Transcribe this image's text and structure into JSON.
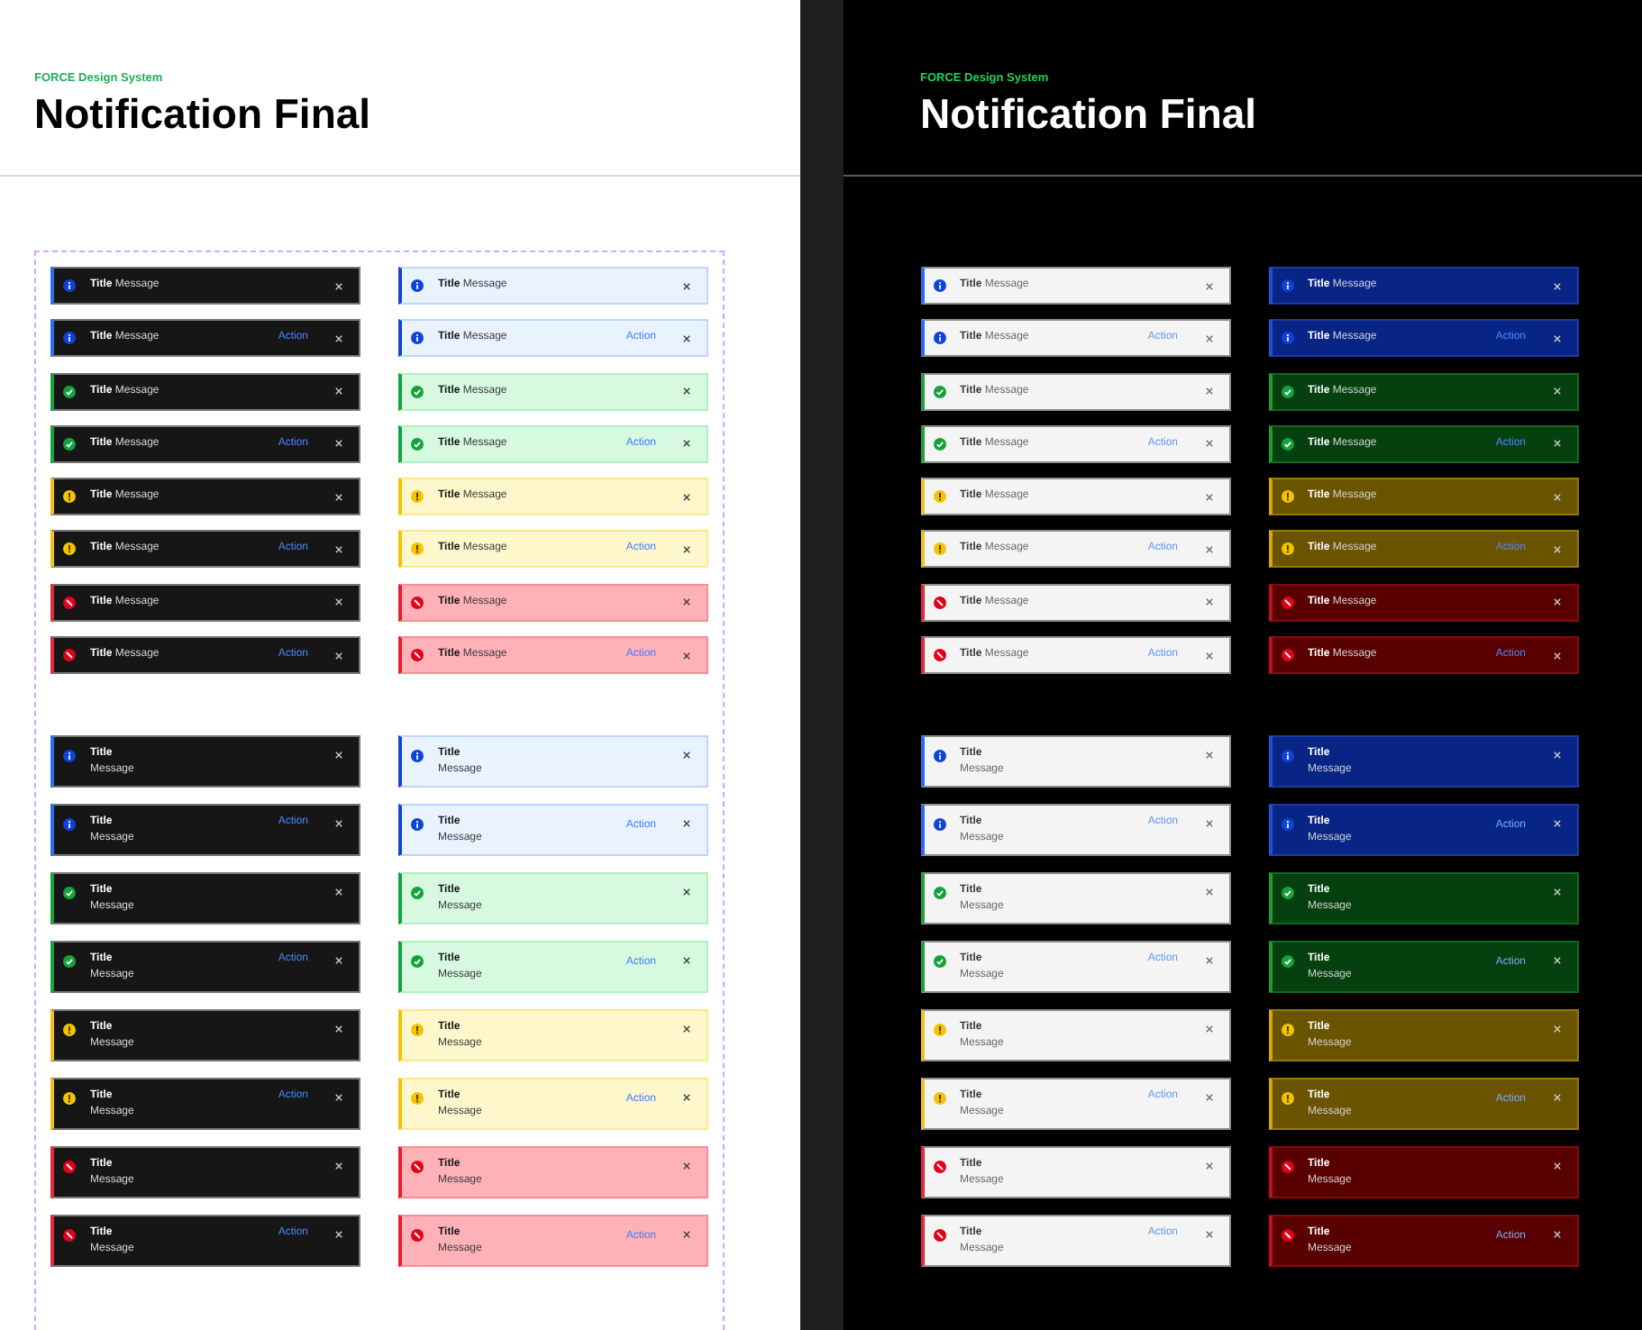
{
  "panels": [
    {
      "eyebrow": "FORCE Design System",
      "title": "Notification Final",
      "framed": true,
      "sections": [
        {
          "columns": [
            {
              "notifications": [
                {
                  "kind": "info",
                  "title": "Title",
                  "message": "Message"
                },
                {
                  "kind": "info",
                  "title": "Title",
                  "message": "Message",
                  "action": "Action"
                },
                {
                  "kind": "success",
                  "title": "Title",
                  "message": "Message"
                },
                {
                  "kind": "success",
                  "title": "Title",
                  "message": "Message",
                  "action": "Action"
                },
                {
                  "kind": "warning",
                  "title": "Title",
                  "message": "Message"
                },
                {
                  "kind": "warning",
                  "title": "Title",
                  "message": "Message",
                  "action": "Action"
                },
                {
                  "kind": "error",
                  "title": "Title",
                  "message": "Message"
                },
                {
                  "kind": "error",
                  "title": "Title",
                  "message": "Message",
                  "action": "Action"
                }
              ]
            },
            {
              "notifications": [
                {
                  "kind": "info",
                  "title": "Title",
                  "message": "Message"
                },
                {
                  "kind": "info",
                  "title": "Title",
                  "message": "Message",
                  "action": "Action"
                },
                {
                  "kind": "success",
                  "title": "Title",
                  "message": "Message"
                },
                {
                  "kind": "success",
                  "title": "Title",
                  "message": "Message",
                  "action": "Action"
                },
                {
                  "kind": "warning",
                  "title": "Title",
                  "message": "Message"
                },
                {
                  "kind": "warning",
                  "title": "Title",
                  "message": "Message",
                  "action": "Action"
                },
                {
                  "kind": "error",
                  "title": "Title",
                  "message": "Message"
                },
                {
                  "kind": "error",
                  "title": "Title",
                  "message": "Message",
                  "action": "Action"
                }
              ]
            }
          ]
        },
        {
          "columns": [
            {
              "notifications": [
                {
                  "kind": "info",
                  "title": "Title",
                  "message": "Message"
                },
                {
                  "kind": "info",
                  "title": "Title",
                  "message": "Message",
                  "action": "Action"
                },
                {
                  "kind": "success",
                  "title": "Title",
                  "message": "Message"
                },
                {
                  "kind": "success",
                  "title": "Title",
                  "message": "Message",
                  "action": "Action"
                },
                {
                  "kind": "warning",
                  "title": "Title",
                  "message": "Message"
                },
                {
                  "kind": "warning",
                  "title": "Title",
                  "message": "Message",
                  "action": "Action"
                },
                {
                  "kind": "error",
                  "title": "Title",
                  "message": "Message"
                },
                {
                  "kind": "error",
                  "title": "Title",
                  "message": "Message",
                  "action": "Action"
                }
              ]
            },
            {
              "notifications": [
                {
                  "kind": "info",
                  "title": "Title",
                  "message": "Message"
                },
                {
                  "kind": "info",
                  "title": "Title",
                  "message": "Message",
                  "action": "Action"
                },
                {
                  "kind": "success",
                  "title": "Title",
                  "message": "Message"
                },
                {
                  "kind": "success",
                  "title": "Title",
                  "message": "Message",
                  "action": "Action"
                },
                {
                  "kind": "warning",
                  "title": "Title",
                  "message": "Message"
                },
                {
                  "kind": "warning",
                  "title": "Title",
                  "message": "Message",
                  "action": "Action"
                },
                {
                  "kind": "error",
                  "title": "Title",
                  "message": "Message"
                },
                {
                  "kind": "error",
                  "title": "Title",
                  "message": "Message",
                  "action": "Action"
                }
              ]
            }
          ]
        }
      ]
    },
    {
      "eyebrow": "FORCE Design System",
      "title": "Notification Final",
      "framed": false,
      "sections": [
        {
          "columns": [
            {
              "notifications": [
                {
                  "kind": "info",
                  "title": "Title",
                  "message": "Message"
                },
                {
                  "kind": "info",
                  "title": "Title",
                  "message": "Message",
                  "action": "Action"
                },
                {
                  "kind": "success",
                  "title": "Title",
                  "message": "Message"
                },
                {
                  "kind": "success",
                  "title": "Title",
                  "message": "Message",
                  "action": "Action"
                },
                {
                  "kind": "warning",
                  "title": "Title",
                  "message": "Message"
                },
                {
                  "kind": "warning",
                  "title": "Title",
                  "message": "Message",
                  "action": "Action"
                },
                {
                  "kind": "error",
                  "title": "Title",
                  "message": "Message"
                },
                {
                  "kind": "error",
                  "title": "Title",
                  "message": "Message",
                  "action": "Action"
                }
              ]
            },
            {
              "notifications": [
                {
                  "kind": "info",
                  "title": "Title",
                  "message": "Message"
                },
                {
                  "kind": "info",
                  "title": "Title",
                  "message": "Message",
                  "action": "Action"
                },
                {
                  "kind": "success",
                  "title": "Title",
                  "message": "Message"
                },
                {
                  "kind": "success",
                  "title": "Title",
                  "message": "Message",
                  "action": "Action"
                },
                {
                  "kind": "warning",
                  "title": "Title",
                  "message": "Message"
                },
                {
                  "kind": "warning",
                  "title": "Title",
                  "message": "Message",
                  "action": "Action"
                },
                {
                  "kind": "error",
                  "title": "Title",
                  "message": "Message"
                },
                {
                  "kind": "error",
                  "title": "Title",
                  "message": "Message",
                  "action": "Action"
                }
              ]
            }
          ]
        },
        {
          "columns": [
            {
              "notifications": [
                {
                  "kind": "info",
                  "title": "Title",
                  "message": "Message"
                },
                {
                  "kind": "info",
                  "title": "Title",
                  "message": "Message",
                  "action": "Action"
                },
                {
                  "kind": "success",
                  "title": "Title",
                  "message": "Message"
                },
                {
                  "kind": "success",
                  "title": "Title",
                  "message": "Message",
                  "action": "Action"
                },
                {
                  "kind": "warning",
                  "title": "Title",
                  "message": "Message"
                },
                {
                  "kind": "warning",
                  "title": "Title",
                  "message": "Message",
                  "action": "Action"
                },
                {
                  "kind": "error",
                  "title": "Title",
                  "message": "Message"
                },
                {
                  "kind": "error",
                  "title": "Title",
                  "message": "Message",
                  "action": "Action"
                }
              ]
            },
            {
              "notifications": [
                {
                  "kind": "info",
                  "title": "Title",
                  "message": "Message"
                },
                {
                  "kind": "info",
                  "title": "Title",
                  "message": "Message",
                  "action": "Action"
                },
                {
                  "kind": "success",
                  "title": "Title",
                  "message": "Message"
                },
                {
                  "kind": "success",
                  "title": "Title",
                  "message": "Message",
                  "action": "Action"
                },
                {
                  "kind": "warning",
                  "title": "Title",
                  "message": "Message"
                },
                {
                  "kind": "warning",
                  "title": "Title",
                  "message": "Message",
                  "action": "Action"
                },
                {
                  "kind": "error",
                  "title": "Title",
                  "message": "Message"
                },
                {
                  "kind": "error",
                  "title": "Title",
                  "message": "Message",
                  "action": "Action"
                }
              ]
            }
          ]
        }
      ]
    }
  ]
}
